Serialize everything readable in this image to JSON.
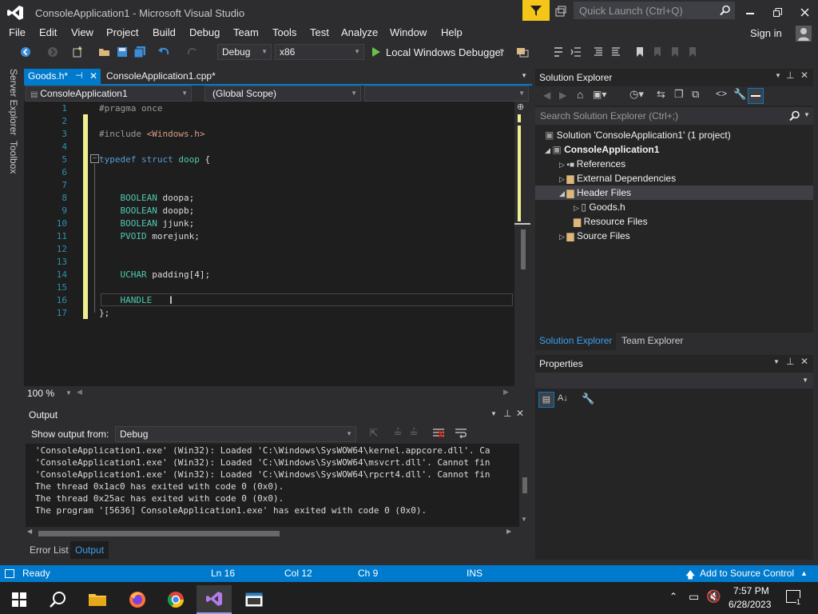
{
  "window": {
    "title": "ConsoleApplication1 - Microsoft Visual Studio",
    "quick_launch_placeholder": "Quick Launch (Ctrl+Q)",
    "sign_in": "Sign in"
  },
  "menu": [
    "File",
    "Edit",
    "View",
    "Project",
    "Build",
    "Debug",
    "Team",
    "Tools",
    "Test",
    "Analyze",
    "Window",
    "Help"
  ],
  "toolbar": {
    "config": "Debug",
    "platform": "x86",
    "debugger": "Local Windows Debugger"
  },
  "tabs": [
    {
      "label": "Goods.h*",
      "active": true
    },
    {
      "label": "ConsoleApplication1.cpp*",
      "active": false
    }
  ],
  "navbar": {
    "project": "ConsoleApplication1",
    "scope": "(Global Scope)"
  },
  "editor": {
    "line_numbers": [
      "1",
      "2",
      "3",
      "4",
      "5",
      "6",
      "7",
      "8",
      "9",
      "10",
      "11",
      "12",
      "13",
      "14",
      "15",
      "16",
      "17"
    ],
    "lines": [
      {
        "n": 1,
        "parts": [
          {
            "t": "#pragma once",
            "c": "pp"
          }
        ]
      },
      {
        "n": 2,
        "parts": []
      },
      {
        "n": 3,
        "parts": [
          {
            "t": "#include ",
            "c": "pp"
          },
          {
            "t": "<Windows.h>",
            "c": "str"
          }
        ]
      },
      {
        "n": 4,
        "parts": []
      },
      {
        "n": 5,
        "parts": [
          {
            "t": "typedef struct ",
            "c": "kw"
          },
          {
            "t": "doop",
            "c": "ty"
          },
          {
            "t": " {",
            "c": ""
          }
        ]
      },
      {
        "n": 6,
        "parts": []
      },
      {
        "n": 7,
        "parts": []
      },
      {
        "n": 8,
        "parts": [
          {
            "t": "    BOOLEAN ",
            "c": "ty"
          },
          {
            "t": "doopa;",
            "c": ""
          }
        ]
      },
      {
        "n": 9,
        "parts": [
          {
            "t": "    BOOLEAN ",
            "c": "ty"
          },
          {
            "t": "doopb;",
            "c": ""
          }
        ]
      },
      {
        "n": 10,
        "parts": [
          {
            "t": "    BOOLEAN ",
            "c": "ty"
          },
          {
            "t": "jjunk;",
            "c": ""
          }
        ]
      },
      {
        "n": 11,
        "parts": [
          {
            "t": "    PVOID ",
            "c": "ty"
          },
          {
            "t": "morejunk;",
            "c": ""
          }
        ]
      },
      {
        "n": 12,
        "parts": []
      },
      {
        "n": 13,
        "parts": []
      },
      {
        "n": 14,
        "parts": [
          {
            "t": "    UCHAR ",
            "c": "ty"
          },
          {
            "t": "padding[4];",
            "c": ""
          }
        ]
      },
      {
        "n": 15,
        "parts": []
      },
      {
        "n": 16,
        "parts": [
          {
            "t": "    HANDLE",
            "c": "ty"
          }
        ]
      },
      {
        "n": 17,
        "parts": [
          {
            "t": "};",
            "c": ""
          }
        ]
      }
    ],
    "zoom": "100 %"
  },
  "output": {
    "title": "Output",
    "show_from_label": "Show output from:",
    "show_from_value": "Debug",
    "lines": [
      "'ConsoleApplication1.exe' (Win32): Loaded 'C:\\Windows\\SysWOW64\\kernel.appcore.dll'. Ca",
      "'ConsoleApplication1.exe' (Win32): Loaded 'C:\\Windows\\SysWOW64\\msvcrt.dll'. Cannot fin",
      "'ConsoleApplication1.exe' (Win32): Loaded 'C:\\Windows\\SysWOW64\\rpcrt4.dll'. Cannot fin",
      "The thread 0x1ac0 has exited with code 0 (0x0).",
      "The thread 0x25ac has exited with code 0 (0x0).",
      "The program '[5636] ConsoleApplication1.exe' has exited with code 0 (0x0)."
    ],
    "bottom_tabs": [
      "Error List",
      "Output"
    ]
  },
  "solution_explorer": {
    "title": "Solution Explorer",
    "search_placeholder": "Search Solution Explorer (Ctrl+;)",
    "items": [
      {
        "label": "Solution 'ConsoleApplication1' (1 project)",
        "bold": false
      },
      {
        "label": "ConsoleApplication1",
        "bold": true
      },
      {
        "label": "References",
        "bold": false
      },
      {
        "label": "External Dependencies",
        "bold": false
      },
      {
        "label": "Header Files",
        "bold": false
      },
      {
        "label": "Goods.h",
        "bold": false
      },
      {
        "label": "Resource Files",
        "bold": false
      },
      {
        "label": "Source Files",
        "bold": false
      }
    ],
    "bottom_tabs": [
      "Solution Explorer",
      "Team Explorer"
    ]
  },
  "properties": {
    "title": "Properties"
  },
  "side_tabs": [
    "Server Explorer",
    "Toolbox"
  ],
  "status": {
    "ready": "Ready",
    "ln": "Ln 16",
    "col": "Col 12",
    "ch": "Ch 9",
    "ins": "INS",
    "source_control": "Add to Source Control"
  },
  "taskbar": {
    "time": "7:57 PM",
    "date": "6/28/2023",
    "notif_count": "1"
  },
  "colors": {
    "accent": "#007acc",
    "bg": "#2d2d30",
    "editor_bg": "#1e1e1e"
  }
}
